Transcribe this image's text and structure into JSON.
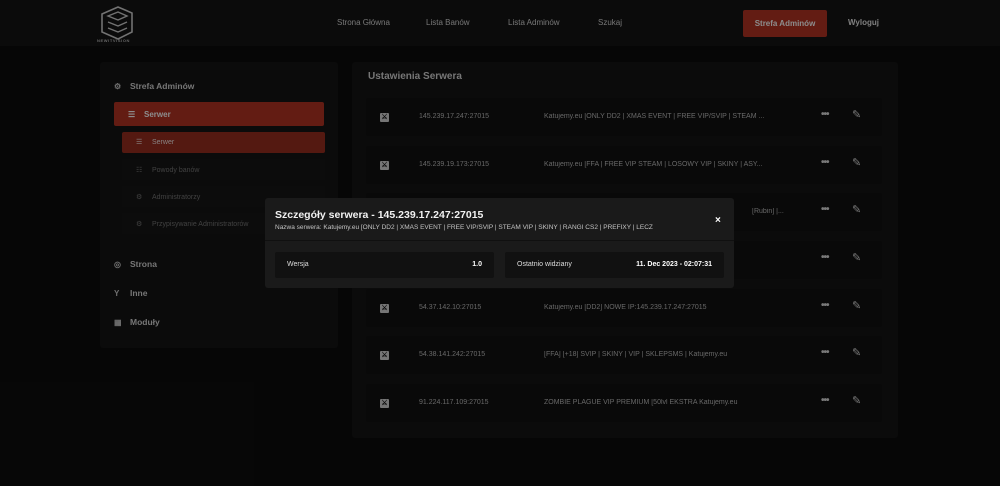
{
  "brand": {
    "name": "NEWITVISION"
  },
  "nav": {
    "links": [
      "Strona Główna",
      "Lista Banów",
      "Lista Adminów",
      "Szukaj"
    ],
    "admin_button": "Strefa Adminów",
    "logout": "Wyloguj"
  },
  "sidebar": {
    "header": "Strefa Adminów",
    "active_section": "Serwer",
    "subitems": [
      "Serwer",
      "Powody banów",
      "Administratorzy",
      "Przypisywanie Administratorów"
    ],
    "other_sections": [
      "Strona",
      "Inne",
      "Moduły"
    ]
  },
  "main": {
    "title": "Ustawienia Serwera",
    "rows": [
      {
        "ip": "145.239.17.247:27015",
        "name": "Katujemy.eu [ONLY DD2 | XMAS EVENT | FREE VIP/SVIP | STEAM ..."
      },
      {
        "ip": "145.239.19.173:27015",
        "name": "Katujemy.eu [FFA | FREE VIP STEAM | LOSOWY VIP | SKINY | ASY..."
      },
      {
        "ip": "",
        "name": "[Rubin] |..."
      },
      {
        "ip": "",
        "name": ""
      },
      {
        "ip": "54.37.142.10:27015",
        "name": "Katujemy.eu [DD2] NOWE IP:145.239.17.247:27015"
      },
      {
        "ip": "54.38.141.242:27015",
        "name": "[FFA] [+18] SVIP | SKINY | VIP | SKLEPSMS | Katujemy.eu"
      },
      {
        "ip": "91.224.117.109:27015",
        "name": "ZOMBIE PLAGUE VIP PREMIUM [50lvl EKSTRA Katujemy.eu"
      }
    ]
  },
  "modal": {
    "title": "Szczegóły serwera - 145.239.17.247:27015",
    "subtitle": "Nazwa serwera: Katujemy.eu [ONLY DD2 | XMAS EVENT | FREE VIP/SVIP | STEAM VIP | SKINY | RANGI CS2 | PREFIXY | LECZ",
    "close": "×",
    "version_label": "Wersja",
    "version_value": "1.0",
    "last_seen_label": "Ostatnio widziany",
    "last_seen_value": "11. Dec 2023 - 02:07:31"
  },
  "colors": {
    "accent": "#b53424",
    "background": "#0c0c0c",
    "panel": "#141414"
  }
}
